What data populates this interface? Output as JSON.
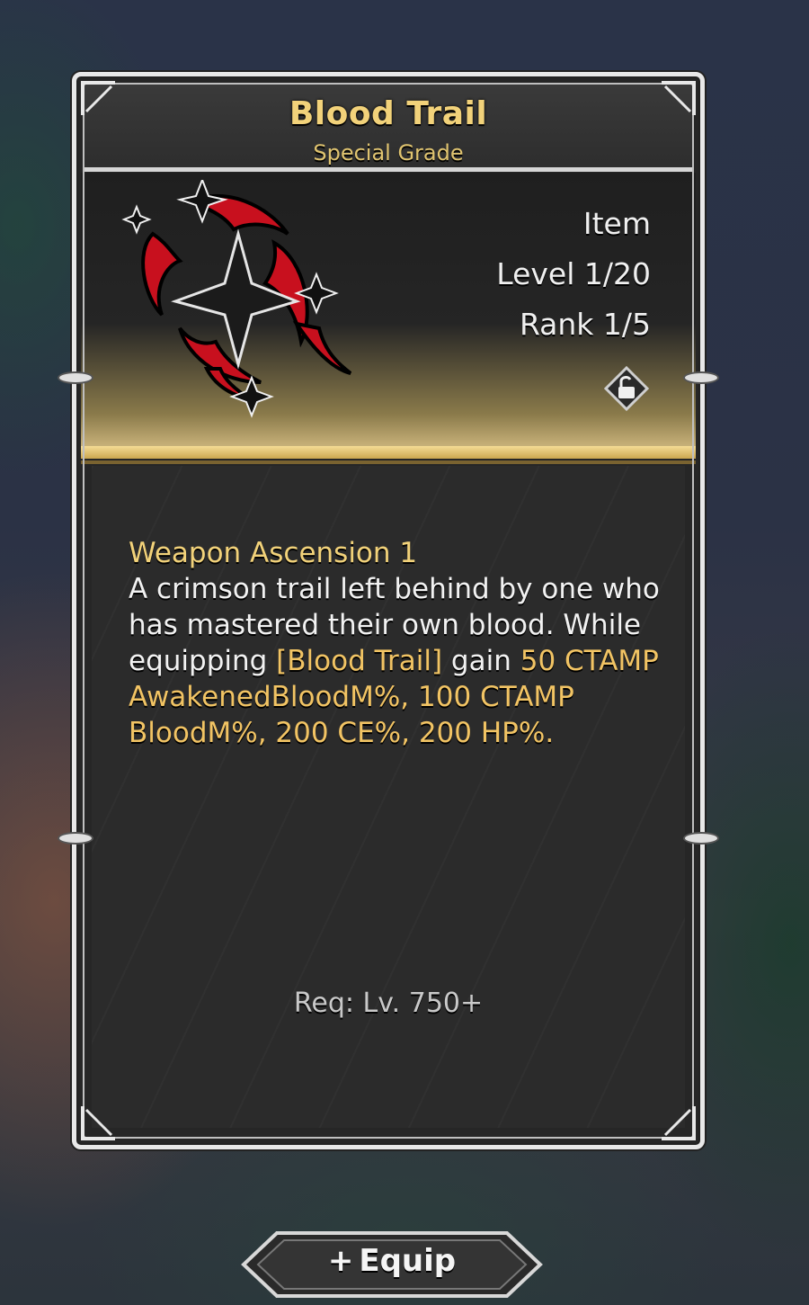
{
  "item": {
    "name": "Blood Trail",
    "grade": "Special Grade",
    "type_label": "Item",
    "level_label": "Level 1/20",
    "rank_label": "Rank 1/5",
    "icon": "blood-shuriken-icon",
    "lock_icon": "unlock-icon"
  },
  "description": {
    "heading": "Weapon Ascension 1",
    "line1": "A crimson trail left behind by one who has mastered their own blood. While equipping ",
    "item_ref": "[Blood Trail]",
    "line2": " gain ",
    "bonuses": "50 CTAMP AwakenedBloodM%, 100 CTAMP BloodM%, 200 CE%, 200 HP%",
    "end": "."
  },
  "requirement": "Req: Lv. 750+",
  "equip_button": {
    "plus": "+",
    "label": "Equip"
  },
  "colors": {
    "gold": "#f2d27a",
    "highlight": "#f2c464",
    "frame": "#e8e8e8"
  }
}
